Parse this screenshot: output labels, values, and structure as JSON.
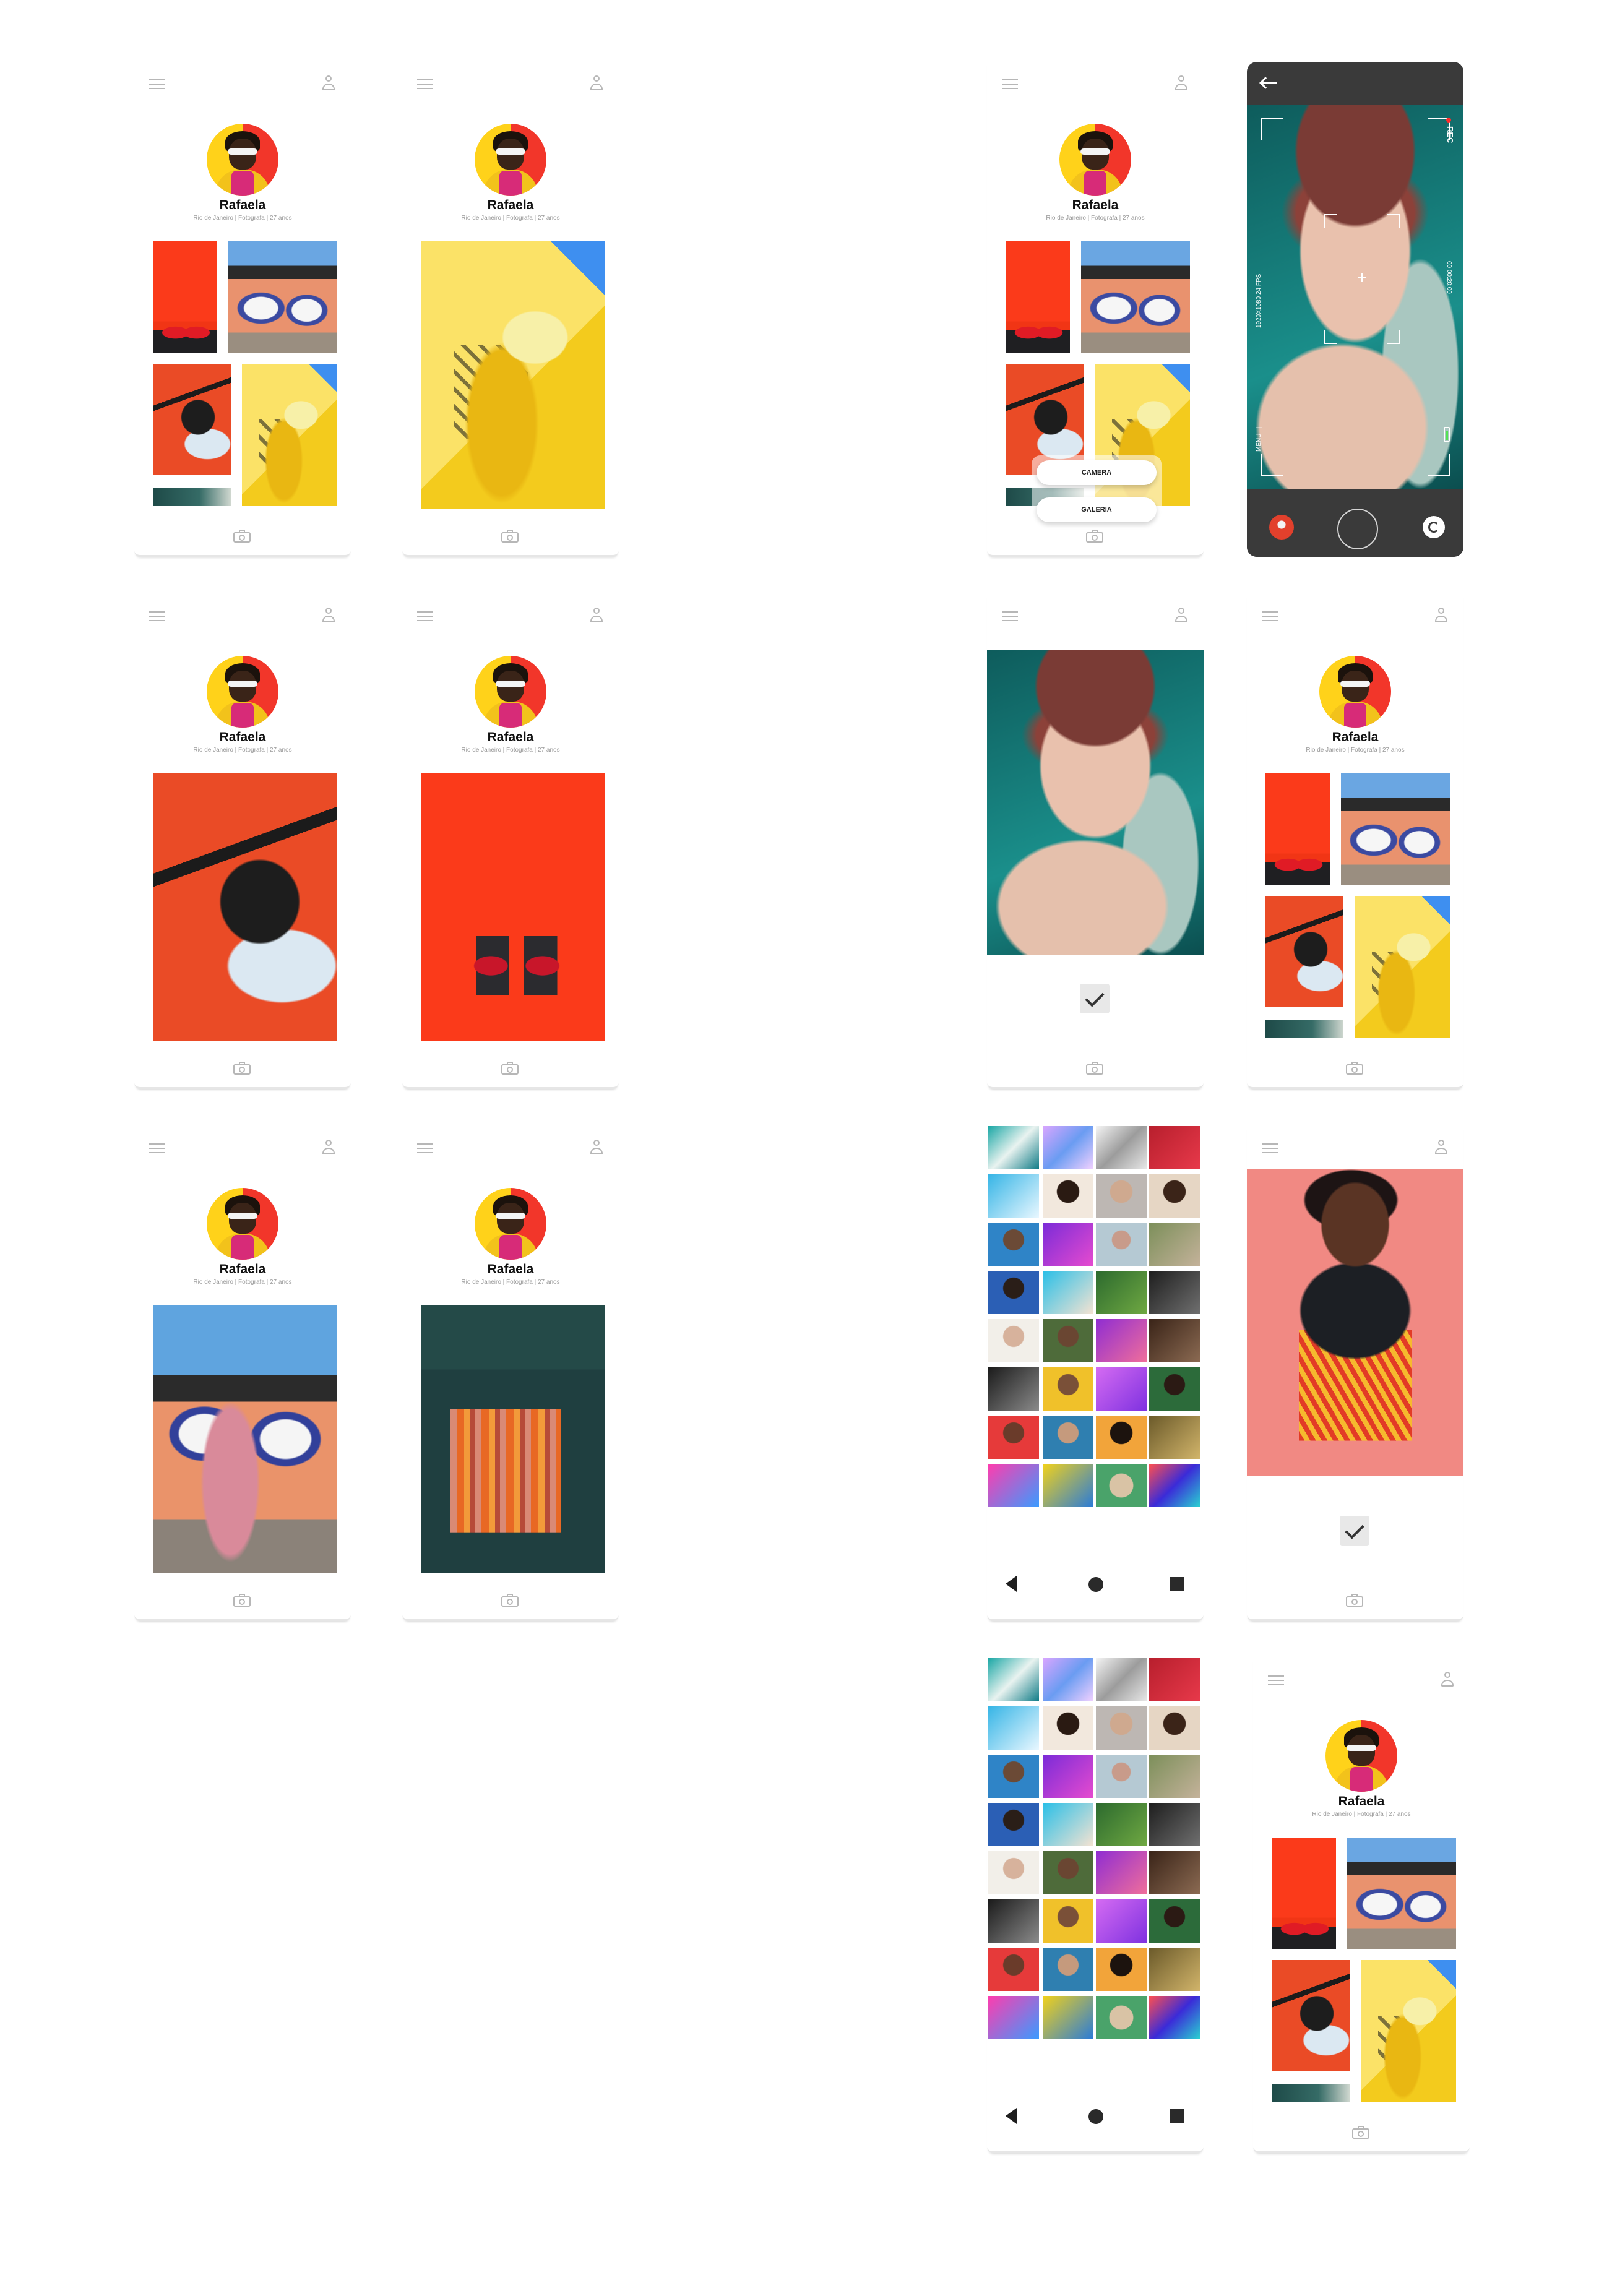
{
  "profile": {
    "name": "Rafaela",
    "subtitle": "Rio de Janeiro | Fotografa | 27 anos"
  },
  "icons": {
    "menu": "hamburger-menu-icon",
    "user": "user-icon",
    "camera": "camera-icon",
    "back": "arrow-left-icon",
    "flip_camera": "flip-camera-icon",
    "confirm": "checkmark-icon"
  },
  "upload_menu": {
    "camera_label": "CAMERA",
    "gallery_label": "GALERIA"
  },
  "camera": {
    "rec_label": "REC",
    "timer": "00:00:20:00",
    "resolution": "1920X1080 24 FPS",
    "mode": "MENU | ||"
  },
  "colors": {
    "accent_red": "#fb3a1a",
    "accent_yellow": "#ffd21a",
    "camera_bg": "#3a3a3a"
  }
}
